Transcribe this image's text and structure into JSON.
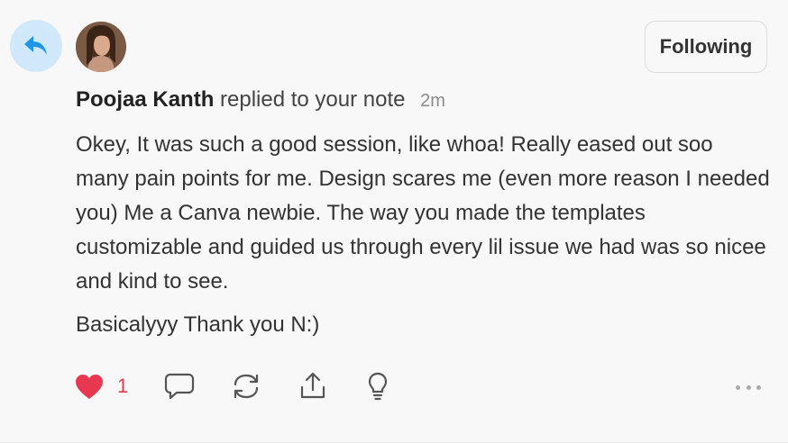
{
  "note": {
    "author": "Poojaa Kanth",
    "action_text": "replied to your note",
    "time": "2m",
    "paragraphs": [
      "Okey, It was such a good session, like whoa! Really eased out soo many pain points for me. Design scares me (even more reason I needed you) Me a Canva newbie. The way you made the templates customizable and guided us through every lil issue we had was so nicee and kind to see.",
      "Basicalyyy Thank you N:)"
    ]
  },
  "follow_button": {
    "label": "Following"
  },
  "actions": {
    "like_count": "1",
    "icons": [
      "heart-icon",
      "comment-icon",
      "restack-icon",
      "share-icon",
      "lightbulb-icon",
      "more-icon"
    ]
  },
  "colors": {
    "reply_bg": "#cfe9fb",
    "reply_icon": "#2196e8",
    "heart": "#e8384f"
  }
}
